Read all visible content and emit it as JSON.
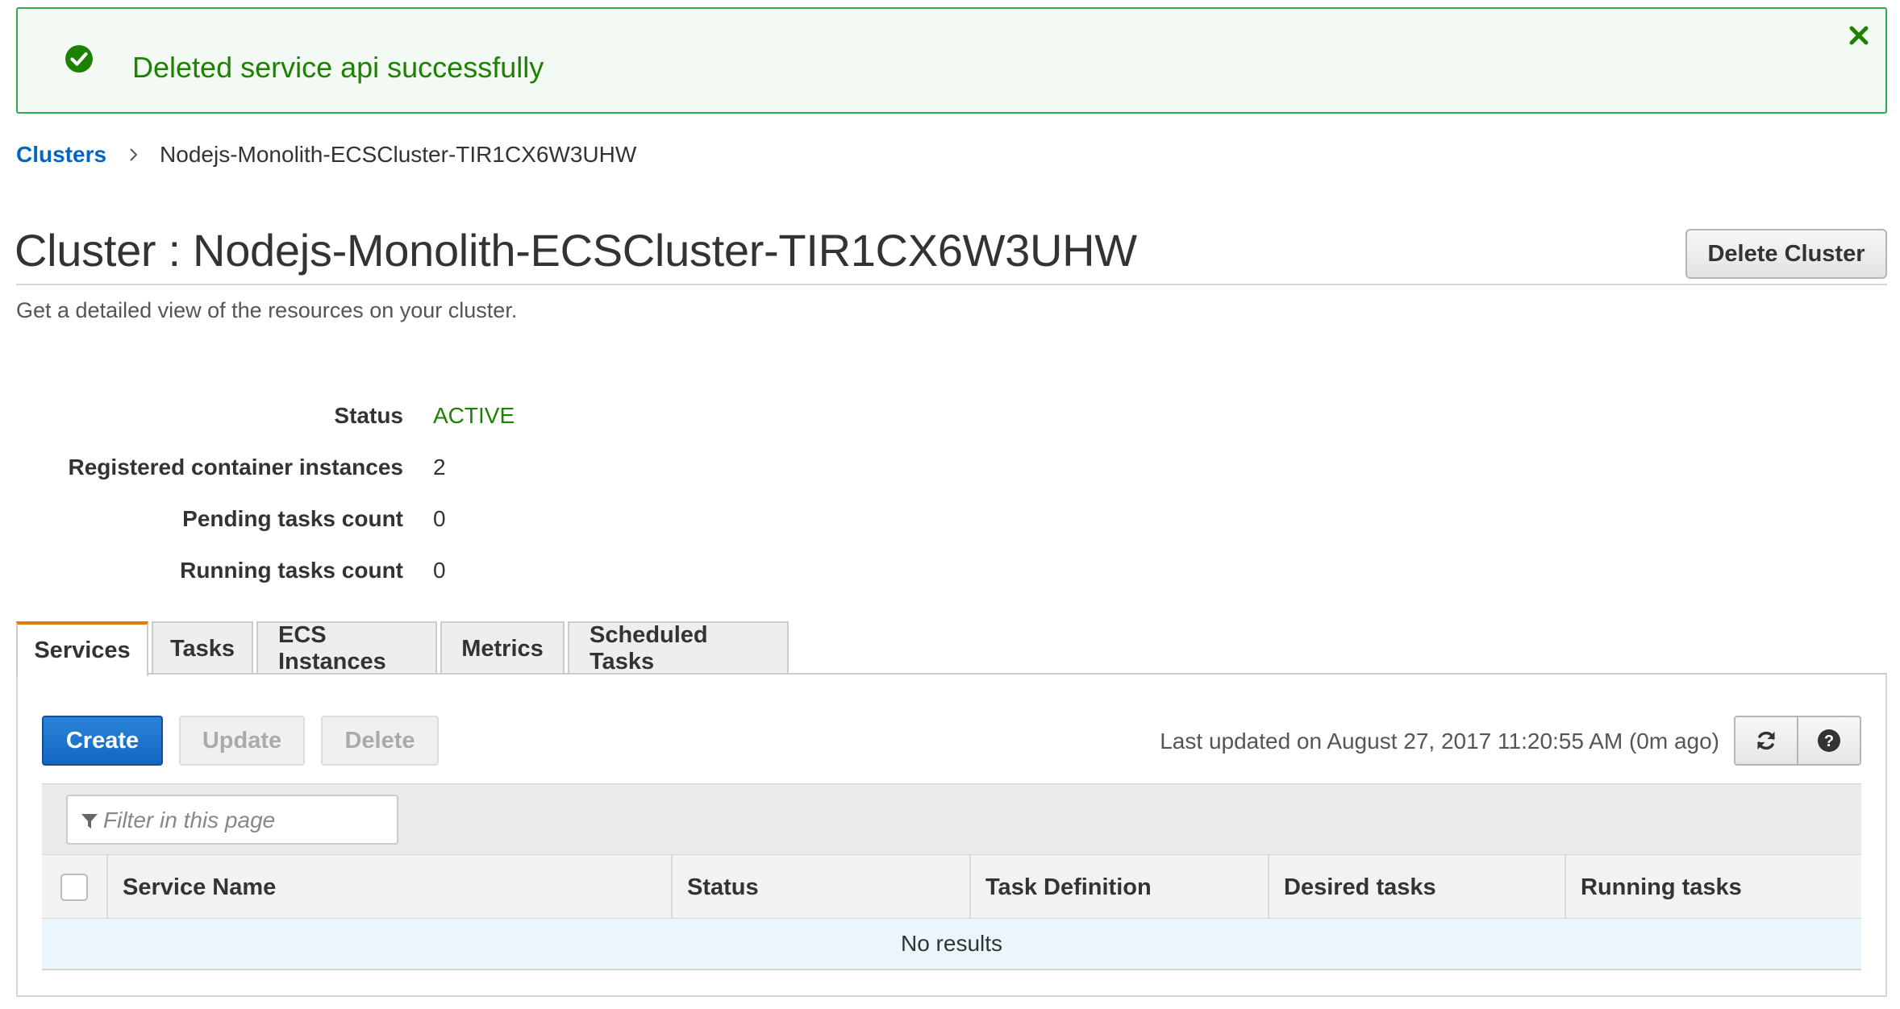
{
  "flash": {
    "message": "Deleted service api successfully",
    "status_color": "#1d8102",
    "icon": "check-circle-icon",
    "close_icon": "close-icon"
  },
  "breadcrumb": {
    "root": "Clusters",
    "current": "Nodejs-Monolith-ECSCluster-TIR1CX6W3UHW"
  },
  "header": {
    "title": "Cluster : Nodejs-Monolith-ECSCluster-TIR1CX6W3UHW",
    "subtitle": "Get a detailed view of the resources on your cluster.",
    "delete_button": "Delete Cluster"
  },
  "details": [
    {
      "label": "Status",
      "value": "ACTIVE"
    },
    {
      "label": "Registered container instances",
      "value": "2"
    },
    {
      "label": "Pending tasks count",
      "value": "0"
    },
    {
      "label": "Running tasks count",
      "value": "0"
    }
  ],
  "tabs": [
    {
      "label": "Services",
      "active": true
    },
    {
      "label": "Tasks",
      "active": false
    },
    {
      "label": "ECS Instances",
      "active": false
    },
    {
      "label": "Metrics",
      "active": false
    },
    {
      "label": "Scheduled Tasks",
      "active": false
    }
  ],
  "toolbar": {
    "create": "Create",
    "update": "Update",
    "delete": "Delete",
    "last_updated": "Last updated on August 27, 2017 11:20:55 AM (0m ago)",
    "refresh_icon": "refresh-icon",
    "help_icon": "help-icon"
  },
  "filter": {
    "placeholder": "Filter in this page",
    "value": ""
  },
  "table": {
    "columns": [
      "Service Name",
      "Status",
      "Task Definition",
      "Desired tasks",
      "Running tasks"
    ],
    "empty_text": "No results"
  },
  "colors": {
    "accent": "#0066c0",
    "active_tab": "#e07b0e",
    "success": "#1d8102",
    "primary_button": "#1466c2"
  }
}
